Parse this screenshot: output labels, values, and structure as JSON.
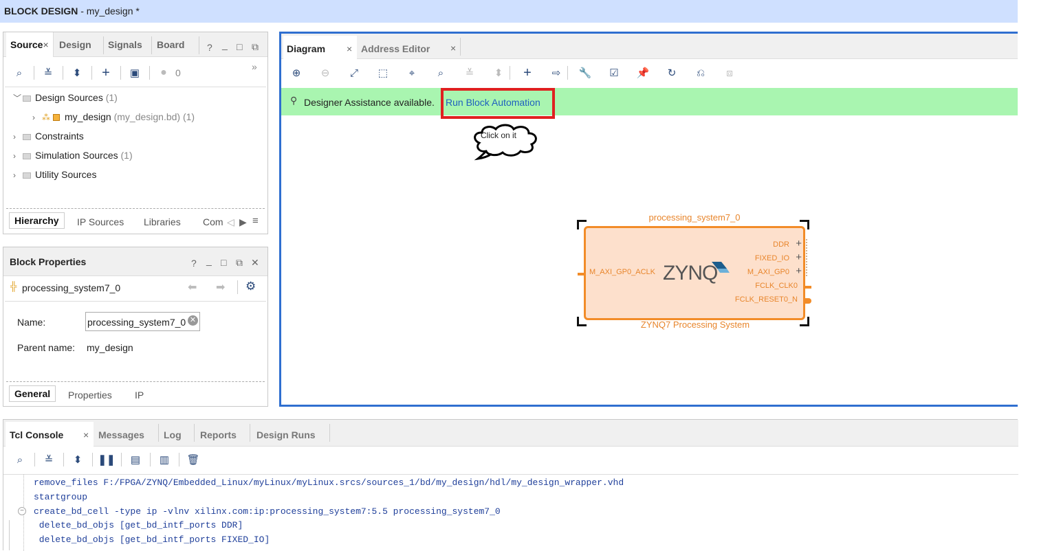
{
  "window": {
    "title_bold": "BLOCK DESIGN",
    "title_rest": " - my_design *"
  },
  "sources": {
    "tabs": [
      "Source",
      "Design",
      "Signals",
      "Board"
    ],
    "tab_close": "×",
    "controls": [
      "?",
      "_",
      "□",
      "⧉"
    ],
    "toolbar_count": "0",
    "more": "»",
    "tree": [
      {
        "label": "Design Sources",
        "suffix": " (1)"
      },
      {
        "label": "my_design",
        "suffix": " (my_design.bd) (1)"
      },
      {
        "label": "Constraints",
        "suffix": ""
      },
      {
        "label": "Simulation Sources",
        "suffix": " (1)"
      },
      {
        "label": "Utility Sources",
        "suffix": ""
      }
    ],
    "bottom_tabs": [
      "Hierarchy",
      "IP Sources",
      "Libraries",
      "Com"
    ]
  },
  "block_properties": {
    "title": "Block Properties",
    "controls": [
      "?",
      "_",
      "□",
      "⧉",
      "✕"
    ],
    "object": "processing_system7_0",
    "name_label": "Name:",
    "name_value": "processing_system7_0",
    "parent_label": "Parent name:",
    "parent_value": "my_design",
    "bottom_tabs": [
      "General",
      "Properties",
      "IP"
    ]
  },
  "diagram": {
    "tabs": [
      "Diagram",
      "Address Editor"
    ],
    "tab_close": "×",
    "banner_text": "Designer Assistance available.",
    "banner_link": "Run Block Automation",
    "callout": "Click on it",
    "block": {
      "name": "processing_system7_0",
      "subtitle": "ZYNQ7 Processing System",
      "logo": "ZYNQ",
      "left_port": "M_AXI_GP0_ACLK",
      "right_ports": [
        "DDR",
        "FIXED_IO",
        "M_AXI_GP0",
        "FCLK_CLK0",
        "FCLK_RESET0_N"
      ]
    }
  },
  "console": {
    "tabs": [
      "Tcl Console",
      "Messages",
      "Log",
      "Reports",
      "Design Runs"
    ],
    "tab_close": "×",
    "lines": [
      "remove_files  F:/FPGA/ZYNQ/Embedded_Linux/myLinux/myLinux.srcs/sources_1/bd/my_design/hdl/my_design_wrapper.vhd",
      "startgroup",
      "create_bd_cell -type ip -vlnv xilinx.com:ip:processing_system7:5.5 processing_system7_0",
      " delete_bd_objs [get_bd_intf_ports DDR]",
      " delete_bd_objs [get_bd_intf_ports FIXED_IO]"
    ]
  },
  "colors": {
    "accent": "#2f6fd0",
    "banner": "#a9f5b0",
    "block_fill": "#fde0cc",
    "block_stroke": "#f28c28",
    "highlight": "#e02020"
  }
}
